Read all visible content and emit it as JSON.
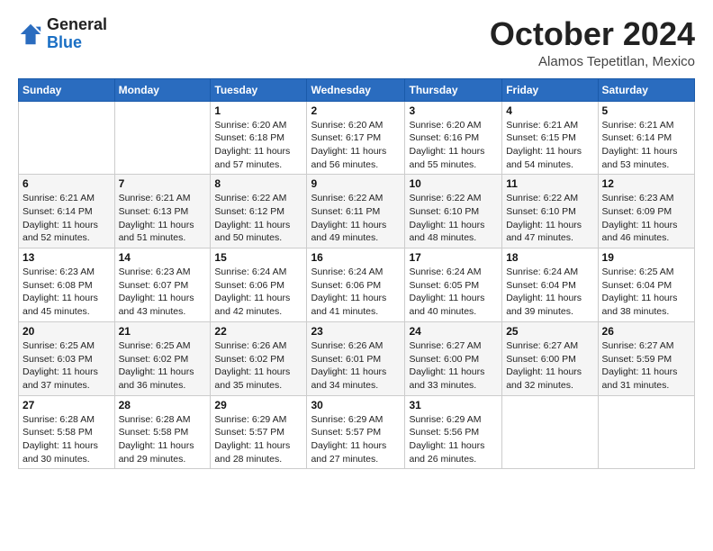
{
  "header": {
    "logo": {
      "general": "General",
      "blue": "Blue"
    },
    "title": "October 2024",
    "location": "Alamos Tepetitlan, Mexico"
  },
  "calendar": {
    "days_of_week": [
      "Sunday",
      "Monday",
      "Tuesday",
      "Wednesday",
      "Thursday",
      "Friday",
      "Saturday"
    ],
    "weeks": [
      [
        {
          "day": "",
          "info": ""
        },
        {
          "day": "",
          "info": ""
        },
        {
          "day": "1",
          "info": "Sunrise: 6:20 AM\nSunset: 6:18 PM\nDaylight: 11 hours and 57 minutes."
        },
        {
          "day": "2",
          "info": "Sunrise: 6:20 AM\nSunset: 6:17 PM\nDaylight: 11 hours and 56 minutes."
        },
        {
          "day": "3",
          "info": "Sunrise: 6:20 AM\nSunset: 6:16 PM\nDaylight: 11 hours and 55 minutes."
        },
        {
          "day": "4",
          "info": "Sunrise: 6:21 AM\nSunset: 6:15 PM\nDaylight: 11 hours and 54 minutes."
        },
        {
          "day": "5",
          "info": "Sunrise: 6:21 AM\nSunset: 6:14 PM\nDaylight: 11 hours and 53 minutes."
        }
      ],
      [
        {
          "day": "6",
          "info": "Sunrise: 6:21 AM\nSunset: 6:14 PM\nDaylight: 11 hours and 52 minutes."
        },
        {
          "day": "7",
          "info": "Sunrise: 6:21 AM\nSunset: 6:13 PM\nDaylight: 11 hours and 51 minutes."
        },
        {
          "day": "8",
          "info": "Sunrise: 6:22 AM\nSunset: 6:12 PM\nDaylight: 11 hours and 50 minutes."
        },
        {
          "day": "9",
          "info": "Sunrise: 6:22 AM\nSunset: 6:11 PM\nDaylight: 11 hours and 49 minutes."
        },
        {
          "day": "10",
          "info": "Sunrise: 6:22 AM\nSunset: 6:10 PM\nDaylight: 11 hours and 48 minutes."
        },
        {
          "day": "11",
          "info": "Sunrise: 6:22 AM\nSunset: 6:10 PM\nDaylight: 11 hours and 47 minutes."
        },
        {
          "day": "12",
          "info": "Sunrise: 6:23 AM\nSunset: 6:09 PM\nDaylight: 11 hours and 46 minutes."
        }
      ],
      [
        {
          "day": "13",
          "info": "Sunrise: 6:23 AM\nSunset: 6:08 PM\nDaylight: 11 hours and 45 minutes."
        },
        {
          "day": "14",
          "info": "Sunrise: 6:23 AM\nSunset: 6:07 PM\nDaylight: 11 hours and 43 minutes."
        },
        {
          "day": "15",
          "info": "Sunrise: 6:24 AM\nSunset: 6:06 PM\nDaylight: 11 hours and 42 minutes."
        },
        {
          "day": "16",
          "info": "Sunrise: 6:24 AM\nSunset: 6:06 PM\nDaylight: 11 hours and 41 minutes."
        },
        {
          "day": "17",
          "info": "Sunrise: 6:24 AM\nSunset: 6:05 PM\nDaylight: 11 hours and 40 minutes."
        },
        {
          "day": "18",
          "info": "Sunrise: 6:24 AM\nSunset: 6:04 PM\nDaylight: 11 hours and 39 minutes."
        },
        {
          "day": "19",
          "info": "Sunrise: 6:25 AM\nSunset: 6:04 PM\nDaylight: 11 hours and 38 minutes."
        }
      ],
      [
        {
          "day": "20",
          "info": "Sunrise: 6:25 AM\nSunset: 6:03 PM\nDaylight: 11 hours and 37 minutes."
        },
        {
          "day": "21",
          "info": "Sunrise: 6:25 AM\nSunset: 6:02 PM\nDaylight: 11 hours and 36 minutes."
        },
        {
          "day": "22",
          "info": "Sunrise: 6:26 AM\nSunset: 6:02 PM\nDaylight: 11 hours and 35 minutes."
        },
        {
          "day": "23",
          "info": "Sunrise: 6:26 AM\nSunset: 6:01 PM\nDaylight: 11 hours and 34 minutes."
        },
        {
          "day": "24",
          "info": "Sunrise: 6:27 AM\nSunset: 6:00 PM\nDaylight: 11 hours and 33 minutes."
        },
        {
          "day": "25",
          "info": "Sunrise: 6:27 AM\nSunset: 6:00 PM\nDaylight: 11 hours and 32 minutes."
        },
        {
          "day": "26",
          "info": "Sunrise: 6:27 AM\nSunset: 5:59 PM\nDaylight: 11 hours and 31 minutes."
        }
      ],
      [
        {
          "day": "27",
          "info": "Sunrise: 6:28 AM\nSunset: 5:58 PM\nDaylight: 11 hours and 30 minutes."
        },
        {
          "day": "28",
          "info": "Sunrise: 6:28 AM\nSunset: 5:58 PM\nDaylight: 11 hours and 29 minutes."
        },
        {
          "day": "29",
          "info": "Sunrise: 6:29 AM\nSunset: 5:57 PM\nDaylight: 11 hours and 28 minutes."
        },
        {
          "day": "30",
          "info": "Sunrise: 6:29 AM\nSunset: 5:57 PM\nDaylight: 11 hours and 27 minutes."
        },
        {
          "day": "31",
          "info": "Sunrise: 6:29 AM\nSunset: 5:56 PM\nDaylight: 11 hours and 26 minutes."
        },
        {
          "day": "",
          "info": ""
        },
        {
          "day": "",
          "info": ""
        }
      ]
    ]
  }
}
